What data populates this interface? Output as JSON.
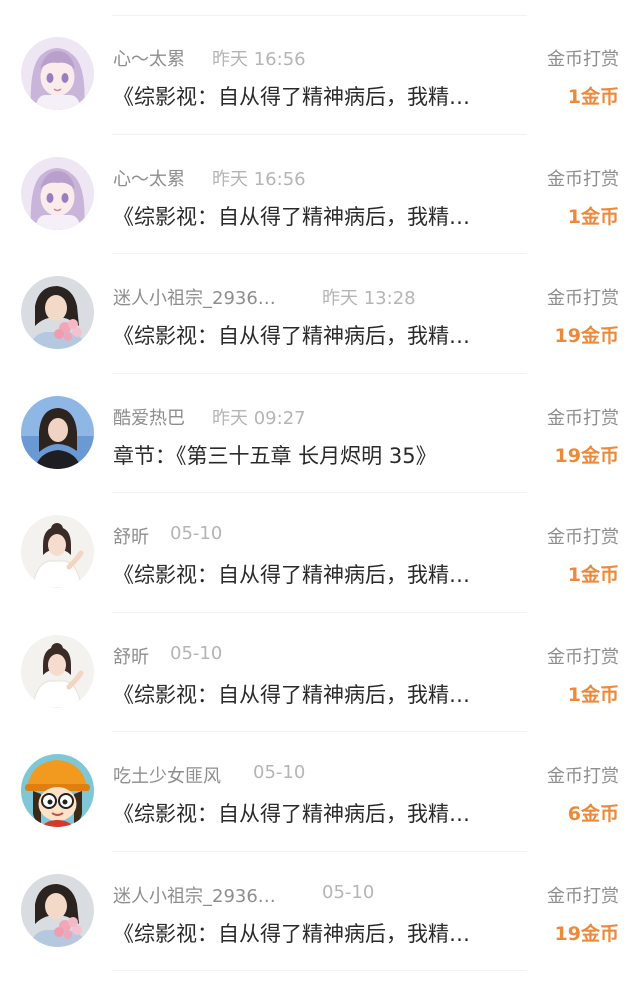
{
  "reward_label": "金币打赏",
  "items": [
    {
      "name": "心～太累",
      "time": "昨天 16:56",
      "content": "《综影视：自从得了精神病后，我精…",
      "amount": "1金币",
      "avatar": "anime-girl-purple-hair"
    },
    {
      "name": "心～太累",
      "time": "昨天 16:56",
      "content": "《综影视：自从得了精神病后，我精…",
      "amount": "1金币",
      "avatar": "anime-girl-purple-hair"
    },
    {
      "name": "迷人小祖宗_2936…",
      "time": "昨天 13:28",
      "content": "《综影视：自从得了精神病后，我精…",
      "amount": "19金币",
      "avatar": "woman-with-flowers"
    },
    {
      "name": "酷爱热巴",
      "time": "昨天 09:27",
      "content": "章节：《第三十五章 长月烬明 35》",
      "amount": "19金币",
      "avatar": "woman-blue-background"
    },
    {
      "name": "舒昕",
      "time": "05-10",
      "content": "《综影视：自从得了精神病后，我精…",
      "amount": "1金币",
      "avatar": "woman-white-sweater"
    },
    {
      "name": "舒昕",
      "time": "05-10",
      "content": "《综影视：自从得了精神病后，我精…",
      "amount": "1金币",
      "avatar": "woman-white-sweater"
    },
    {
      "name": "吃土少女匪风",
      "time": "05-10",
      "content": "《综影视：自从得了精神病后，我精…",
      "amount": "6金币",
      "avatar": "cartoon-girl-orange-hat"
    },
    {
      "name": "迷人小祖宗_2936…",
      "time": "05-10",
      "content": "《综影视：自从得了精神病后，我精…",
      "amount": "19金币",
      "avatar": "woman-with-flowers"
    }
  ]
}
